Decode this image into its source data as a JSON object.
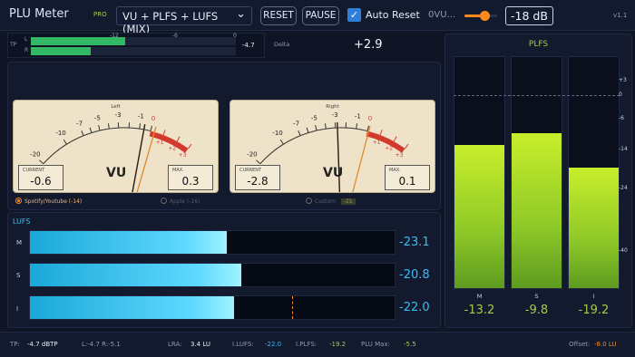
{
  "header": {
    "title": "PLU Meter",
    "badge": "PRO",
    "preset": "VU + PLFS + LUFS (MIX)",
    "reset_label": "RESET",
    "pause_label": "PAUSE",
    "auto_reset_label": "Auto Reset",
    "auto_reset_checked": true,
    "zero_vu_label": "0VU...",
    "zero_vu_slider": 0.6,
    "ref_level": "-18 dB",
    "version": "v1.1"
  },
  "tp": {
    "label": "TP",
    "left_label": "L",
    "right_label": "R",
    "scale": [
      "-12",
      "-6",
      "0"
    ],
    "left_fill": 0.46,
    "right_fill": 0.29,
    "value": "-4.7"
  },
  "delta": {
    "label": "Delta",
    "value": "+2.9"
  },
  "vu": {
    "left": {
      "title": "Left",
      "current_label": "CURRENT",
      "current_value": "-0.6",
      "max_label": "MAX.",
      "max_value": "0.3",
      "needle_vu": -0.6,
      "max_vu": 0.3
    },
    "right": {
      "title": "Right",
      "current_label": "CURRENT",
      "current_value": "-2.8",
      "max_label": "MAX.",
      "max_value": "0.1",
      "needle_vu": -2.8,
      "max_vu": 0.1
    },
    "unit": "VU",
    "scale_black": [
      "-20",
      "-10",
      "-7",
      "-5",
      "-3",
      "-1"
    ],
    "scale_red": [
      "+1",
      "+2",
      "+3"
    ],
    "scale_zero": "0"
  },
  "targets": {
    "spotify": {
      "label": "Spotify/Youtube (-14)",
      "selected": true
    },
    "apple": {
      "label": "Apple (-16)",
      "selected": false
    },
    "custom": {
      "label": "Custom",
      "value": "-21",
      "selected": false
    }
  },
  "lufs": {
    "title": "LUFS",
    "rows": [
      {
        "label": "M",
        "value": "-23.1",
        "fill": 0.54
      },
      {
        "label": "S",
        "value": "-20.8",
        "fill": 0.58
      },
      {
        "label": "I",
        "value": "-22.0",
        "fill": 0.56,
        "target_marker": 0.72
      }
    ]
  },
  "plfs": {
    "title": "PLFS",
    "scale": [
      "+3",
      "0",
      "-6",
      "-14",
      "-24",
      "-40"
    ],
    "columns": [
      {
        "label": "M",
        "value": "-13.2",
        "fill": 0.62
      },
      {
        "label": "S",
        "value": "-9.8",
        "fill": 0.67
      },
      {
        "label": "I",
        "value": "-19.2",
        "fill": 0.52
      }
    ]
  },
  "footer": {
    "tp_label": "TP:",
    "tp_value": "-4.7 dBTP",
    "lr_value": "L:-4.7  R:-5.1",
    "lra_label": "LRA:",
    "lra_value": "3.4 LU",
    "ilufs_label": "I.LUFS:",
    "ilufs_value": "-22.0",
    "iplfs_label": "I.PLFS:",
    "iplfs_value": "-19.2",
    "plumax_label": "PLU Max:",
    "plumax_value": "-5.5",
    "offset_label": "Offset:",
    "offset_value": "-8.0 LU"
  },
  "colors": {
    "accent_green": "#a7c94a",
    "lufs_blue": "#38bdf8",
    "tp_green": "#33b865",
    "accent_orange": "#ff8a1c"
  }
}
